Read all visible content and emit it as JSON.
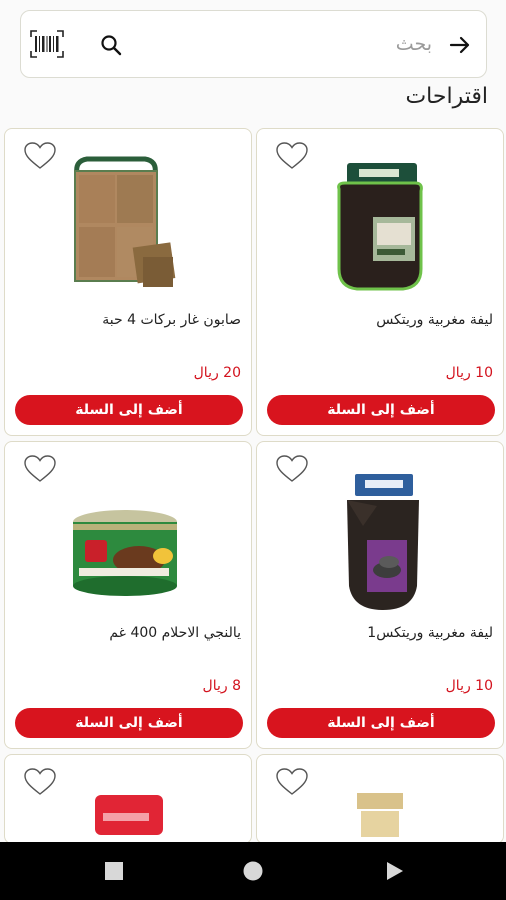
{
  "search": {
    "placeholder": "بحث"
  },
  "section": {
    "title": "اقتراحات"
  },
  "products": [
    {
      "name": "صابون غار بركات 4 حبة",
      "price": "20 ريال",
      "add_label": "أضف إلى السلة"
    },
    {
      "name": "ليفة مغربية وريتكس",
      "price": "10 ريال",
      "add_label": "أضف إلى السلة"
    },
    {
      "name": "يالنجي الاحلام 400 غم",
      "price": "8 ريال",
      "add_label": "أضف إلى السلة"
    },
    {
      "name": "ليفة مغربية وريتكس1",
      "price": "10 ريال",
      "add_label": "أضف إلى السلة"
    }
  ],
  "colors": {
    "accent": "#d8141e",
    "price": "#d3121d",
    "card_border": "#dedbc8"
  },
  "icons": [
    "arrow-right-icon",
    "search-icon",
    "barcode-icon",
    "heart-icon",
    "nav-square-icon",
    "nav-circle-icon",
    "nav-triangle-icon"
  ]
}
